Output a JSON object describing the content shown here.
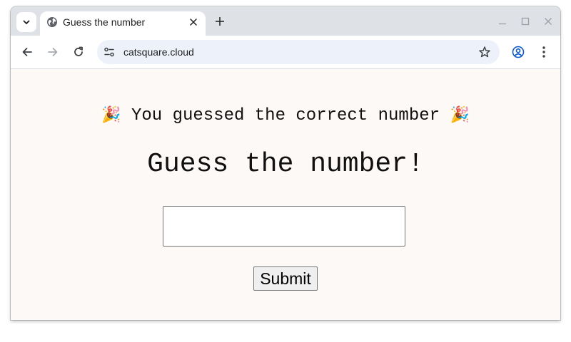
{
  "browser": {
    "tab": {
      "title": "Guess the number",
      "favicon": "globe-icon"
    },
    "address_bar": {
      "url": "catsquare.cloud"
    }
  },
  "page": {
    "message": "You guessed the correct number",
    "message_emoji": "🎉",
    "heading": "Guess the number!",
    "input": {
      "value": "",
      "placeholder": ""
    },
    "submit_label": "Submit"
  },
  "colors": {
    "page_background": "#fdf9f6",
    "tabstrip": "#dee1e6",
    "omnibox": "#edf2fa",
    "profile_accent": "#0b57d0"
  }
}
